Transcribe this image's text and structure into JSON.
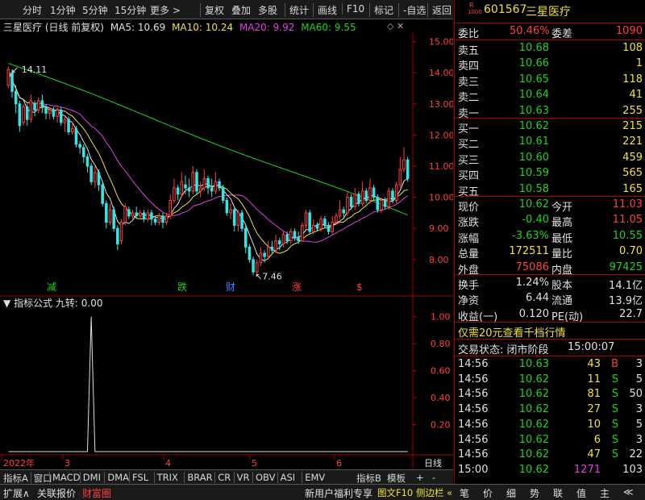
{
  "toolbar": {
    "items": [
      "分时",
      "1分钟",
      "5分钟",
      "15分钟",
      "更多 >",
      "复权",
      "叠加",
      "多股",
      "统计",
      "画线",
      "F10",
      "标记",
      "-自选",
      "返回"
    ]
  },
  "chart_header": {
    "title": "三星医疗 (日线 前复权)",
    "ma5": "MA5: 10.69",
    "ma10": "MA10: 10.24",
    "ma20": "MA20: 9.92",
    "ma60": "MA60: 9.55",
    "colors": {
      "ma5": "#e0e0e0",
      "ma10": "#f0e040",
      "ma20": "#e040e0",
      "ma60": "#20d020"
    }
  },
  "chart_data": [
    {
      "type": "candlestick",
      "title": "三星医疗 (日线 前复权)",
      "ylim": [
        7.4,
        15.3
      ],
      "y_ticks": [
        "15.00",
        "14.00",
        "13.00",
        "12.00",
        "11.00",
        "10.00",
        "9.00",
        "8.00"
      ],
      "annotations": {
        "high": "14.11",
        "low": "7.46"
      },
      "signal_labels": [
        "减",
        "跌",
        "财",
        "涨",
        "$"
      ],
      "x_ticks": [
        "2022年",
        "3",
        "4",
        "5",
        "6"
      ],
      "candles": [
        [
          13.6,
          14.1,
          14.2,
          13.5
        ],
        [
          14.0,
          13.4,
          14.1,
          13.2
        ],
        [
          13.4,
          13.0,
          13.6,
          12.7
        ],
        [
          13.0,
          12.3,
          13.1,
          12.1
        ],
        [
          12.4,
          12.9,
          13.0,
          12.3
        ],
        [
          12.9,
          12.5,
          13.0,
          12.3
        ],
        [
          12.5,
          13.1,
          13.3,
          12.4
        ],
        [
          13.0,
          12.8,
          13.1,
          12.6
        ],
        [
          12.8,
          13.1,
          13.2,
          12.7
        ],
        [
          13.1,
          12.9,
          13.3,
          12.7
        ],
        [
          12.9,
          12.7,
          13.0,
          12.5
        ],
        [
          12.7,
          12.8,
          12.9,
          12.5
        ],
        [
          12.8,
          12.6,
          12.9,
          12.5
        ],
        [
          12.6,
          12.8,
          12.9,
          12.4
        ],
        [
          12.8,
          12.4,
          12.9,
          12.3
        ],
        [
          12.4,
          12.5,
          12.6,
          12.1
        ],
        [
          12.5,
          12.1,
          12.6,
          12.0
        ],
        [
          12.1,
          12.2,
          12.4,
          12.0
        ],
        [
          12.2,
          11.7,
          12.3,
          11.6
        ],
        [
          11.7,
          11.6,
          11.8,
          11.4
        ],
        [
          11.6,
          11.3,
          11.7,
          11.1
        ],
        [
          11.3,
          11.0,
          11.4,
          10.8
        ],
        [
          11.0,
          10.5,
          11.1,
          10.4
        ],
        [
          10.5,
          10.8,
          11.0,
          10.3
        ],
        [
          10.8,
          10.4,
          10.9,
          10.2
        ],
        [
          10.4,
          9.8,
          10.5,
          9.7
        ],
        [
          9.8,
          9.2,
          9.9,
          9.0
        ],
        [
          9.2,
          9.6,
          9.8,
          9.1
        ],
        [
          9.6,
          9.0,
          9.7,
          8.9
        ],
        [
          9.0,
          8.5,
          9.1,
          8.3
        ],
        [
          8.6,
          9.2,
          9.3,
          8.5
        ],
        [
          9.2,
          9.7,
          9.8,
          9.1
        ],
        [
          9.6,
          9.4,
          9.7,
          9.3
        ],
        [
          9.4,
          9.5,
          9.6,
          9.3
        ],
        [
          9.5,
          9.4,
          9.7,
          9.3
        ],
        [
          9.4,
          9.5,
          9.6,
          9.3
        ],
        [
          9.5,
          9.3,
          9.6,
          9.2
        ],
        [
          9.3,
          9.5,
          9.6,
          9.2
        ],
        [
          9.5,
          9.3,
          9.6,
          9.1
        ],
        [
          9.3,
          9.2,
          9.4,
          9.1
        ],
        [
          9.2,
          9.4,
          9.5,
          9.1
        ],
        [
          9.4,
          9.2,
          9.5,
          9.0
        ],
        [
          9.2,
          9.4,
          9.5,
          9.1
        ],
        [
          9.4,
          9.9,
          10.1,
          9.3
        ],
        [
          9.9,
          10.3,
          10.6,
          9.8
        ],
        [
          10.3,
          10.1,
          10.4,
          9.9
        ],
        [
          10.1,
          10.5,
          10.8,
          10.0
        ],
        [
          10.4,
          10.3,
          10.7,
          10.1
        ],
        [
          10.3,
          10.2,
          10.6,
          10.0
        ],
        [
          10.2,
          10.8,
          11.0,
          10.1
        ],
        [
          10.8,
          10.2,
          10.9,
          10.1
        ],
        [
          10.2,
          10.3,
          10.5,
          10.0
        ],
        [
          10.3,
          10.6,
          10.9,
          10.2
        ],
        [
          10.6,
          10.3,
          10.7,
          10.1
        ],
        [
          10.3,
          10.2,
          10.6,
          10.0
        ],
        [
          10.2,
          10.5,
          10.8,
          10.1
        ],
        [
          10.5,
          10.3,
          10.6,
          10.2
        ],
        [
          10.3,
          9.9,
          10.4,
          9.8
        ],
        [
          9.9,
          9.5,
          10.0,
          9.4
        ],
        [
          9.5,
          9.6,
          9.8,
          9.3
        ],
        [
          9.6,
          9.1,
          9.7,
          8.9
        ],
        [
          9.1,
          9.5,
          9.6,
          8.9
        ],
        [
          9.5,
          9.0,
          9.6,
          8.9
        ],
        [
          9.0,
          8.4,
          9.1,
          8.2
        ],
        [
          8.4,
          8.0,
          8.5,
          7.9
        ],
        [
          8.0,
          7.6,
          8.1,
          7.5
        ],
        [
          7.6,
          7.9,
          8.0,
          7.5
        ],
        [
          7.9,
          8.2,
          8.4,
          7.8
        ],
        [
          8.2,
          8.1,
          8.3,
          7.9
        ],
        [
          8.1,
          8.4,
          8.6,
          8.0
        ],
        [
          8.4,
          8.3,
          8.6,
          8.2
        ],
        [
          8.3,
          8.6,
          8.8,
          8.2
        ],
        [
          8.6,
          8.5,
          8.7,
          8.3
        ],
        [
          8.5,
          8.8,
          8.9,
          8.4
        ],
        [
          8.8,
          8.6,
          8.9,
          8.5
        ],
        [
          8.6,
          8.9,
          9.0,
          8.5
        ],
        [
          8.9,
          8.7,
          9.0,
          8.6
        ],
        [
          8.7,
          8.6,
          8.9,
          8.5
        ],
        [
          8.6,
          9.1,
          9.2,
          8.6
        ],
        [
          9.1,
          9.5,
          9.6,
          9.0
        ],
        [
          9.5,
          8.9,
          9.6,
          8.8
        ],
        [
          8.9,
          9.1,
          9.3,
          8.8
        ],
        [
          9.1,
          9.0,
          9.2,
          8.9
        ],
        [
          9.0,
          9.3,
          9.4,
          8.9
        ],
        [
          9.3,
          9.1,
          9.4,
          9.0
        ],
        [
          9.1,
          8.9,
          9.2,
          8.8
        ],
        [
          8.9,
          9.2,
          9.4,
          8.8
        ],
        [
          9.2,
          9.4,
          9.5,
          9.1
        ],
        [
          9.4,
          9.6,
          9.9,
          9.3
        ],
        [
          9.6,
          9.5,
          9.7,
          9.3
        ],
        [
          9.5,
          10.0,
          10.2,
          9.4
        ],
        [
          10.0,
          9.7,
          10.1,
          9.6
        ],
        [
          9.7,
          10.1,
          10.3,
          9.6
        ],
        [
          10.1,
          9.8,
          10.2,
          9.7
        ],
        [
          9.8,
          10.2,
          10.5,
          9.7
        ],
        [
          10.2,
          9.9,
          10.3,
          9.8
        ],
        [
          9.9,
          10.3,
          10.6,
          9.8
        ],
        [
          10.3,
          10.0,
          10.4,
          9.9
        ],
        [
          10.0,
          9.6,
          10.1,
          9.5
        ],
        [
          9.6,
          9.9,
          10.0,
          9.5
        ],
        [
          9.9,
          9.7,
          10.0,
          9.6
        ],
        [
          9.7,
          10.2,
          10.3,
          9.6
        ],
        [
          10.2,
          9.9,
          10.3,
          9.8
        ],
        [
          9.9,
          10.4,
          10.5,
          9.8
        ],
        [
          10.4,
          10.9,
          11.3,
          10.3
        ],
        [
          10.9,
          11.2,
          11.6,
          10.8
        ],
        [
          11.2,
          10.6,
          11.3,
          10.5
        ]
      ]
    },
    {
      "type": "line",
      "title": "指标公式 九转: 0.00",
      "ylim": [
        0,
        1.1
      ],
      "y_ticks": [
        "1.00",
        "0.80",
        "0.60",
        "0.40",
        "0.20"
      ],
      "spike_index": 22,
      "values_note": "single spike to 1.00"
    }
  ],
  "indicator": {
    "label": "指标公式",
    "value": "九转: 0.00"
  },
  "quote": {
    "code": "601567",
    "name": "三星医疗",
    "weibi_label": "委比",
    "weibi": "50.46%",
    "weicha_label": "委差",
    "weicha": "1090",
    "asks": [
      {
        "label": "卖五",
        "price": "10.68",
        "vol": "108"
      },
      {
        "label": "卖四",
        "price": "10.66",
        "vol": "1"
      },
      {
        "label": "卖三",
        "price": "10.65",
        "vol": "118"
      },
      {
        "label": "卖二",
        "price": "10.64",
        "vol": "41"
      },
      {
        "label": "卖一",
        "price": "10.63",
        "vol": "255"
      }
    ],
    "bids": [
      {
        "label": "买一",
        "price": "10.62",
        "vol": "215"
      },
      {
        "label": "买二",
        "price": "10.61",
        "vol": "221"
      },
      {
        "label": "买三",
        "price": "10.60",
        "vol": "459"
      },
      {
        "label": "买四",
        "price": "10.59",
        "vol": "565"
      },
      {
        "label": "买五",
        "price": "10.58",
        "vol": "165"
      }
    ],
    "stats": [
      {
        "l1": "现价",
        "v1": "10.62",
        "l2": "今开",
        "v2": "11.03",
        "c1": "green",
        "c2": "red"
      },
      {
        "l1": "涨跌",
        "v1": "-0.40",
        "l2": "最高",
        "v2": "11.05",
        "c1": "green",
        "c2": "red"
      },
      {
        "l1": "涨幅",
        "v1": "-3.63%",
        "l2": "最低",
        "v2": "10.55",
        "c1": "green",
        "c2": "green"
      },
      {
        "l1": "总量",
        "v1": "172511",
        "l2": "量比",
        "v2": "0.70",
        "c1": "yellow",
        "c2": "yellow"
      },
      {
        "l1": "外盘",
        "v1": "75086",
        "l2": "内盘",
        "v2": "97425",
        "c1": "red",
        "c2": "green"
      }
    ],
    "stats2": [
      {
        "l1": "换手",
        "v1": "1.24%",
        "l2": "股本",
        "v2": "14.1亿"
      },
      {
        "l1": "净资",
        "v1": "6.44",
        "l2": "流通",
        "v2": "13.9亿"
      },
      {
        "l1": "收益(一)",
        "v1": "0.120",
        "l2": "PE(动)",
        "v2": "22.7"
      }
    ],
    "promo": "仅需20元查看千档行情",
    "trade_status": "交易状态: 闭市阶段",
    "trade_time": "15:00:07",
    "ticks": [
      {
        "t": "14:56",
        "p": "10.63",
        "v": "43",
        "d": "B",
        "n": "3"
      },
      {
        "t": "14:56",
        "p": "10.62",
        "v": "11",
        "d": "S",
        "n": "5"
      },
      {
        "t": "14:56",
        "p": "10.62",
        "v": "81",
        "d": "S",
        "n": "50"
      },
      {
        "t": "14:56",
        "p": "10.62",
        "v": "27",
        "d": "S",
        "n": "3"
      },
      {
        "t": "14:56",
        "p": "10.62",
        "v": "10",
        "d": "S",
        "n": "5"
      },
      {
        "t": "14:56",
        "p": "10.62",
        "v": "6",
        "d": "S",
        "n": "3"
      },
      {
        "t": "14:56",
        "p": "10.62",
        "v": "47",
        "d": "S",
        "n": "22"
      },
      {
        "t": "15:00",
        "p": "10.62",
        "v": "1271",
        "d": "",
        "n": "103"
      }
    ]
  },
  "indicator_tabs": [
    "指标A",
    "窗口",
    "MACD",
    "DMI",
    "DMA",
    "FSL",
    "TRIX",
    "BRAR",
    "CR",
    "VR",
    "OBV",
    "ASI",
    "EMV"
  ],
  "indicator_tabs_right": [
    "指标B",
    "模板",
    "+",
    "-"
  ],
  "period": "日线",
  "status": {
    "left": [
      "扩展∧",
      "关联报价",
      "财富圈"
    ],
    "mid": [
      "新用户福利专享",
      "图文F10",
      "侧边栏 «"
    ],
    "right": [
      "笔",
      "价",
      "细",
      "势",
      "联",
      "值",
      "主",
      "≪"
    ]
  }
}
